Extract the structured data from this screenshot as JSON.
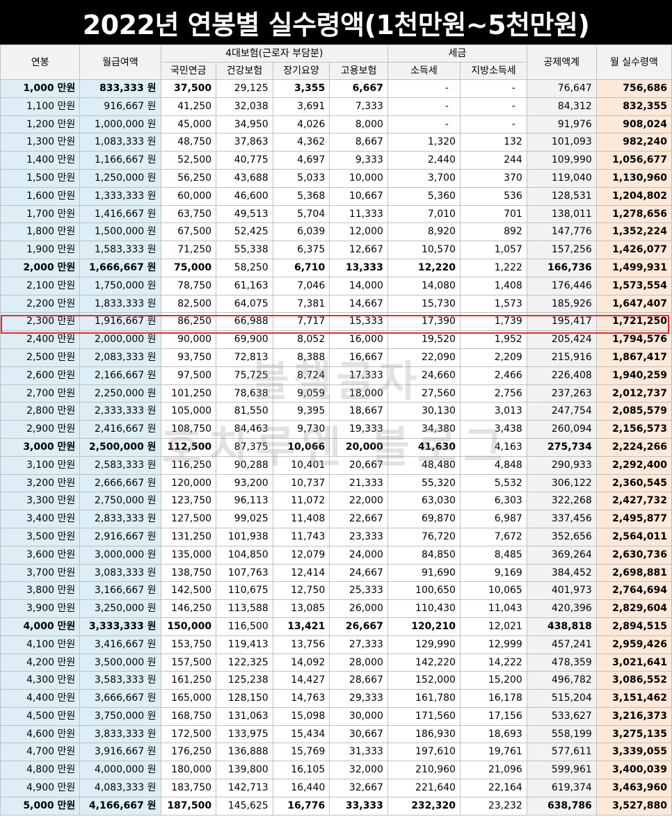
{
  "title": "2022년 연봉별 실수령액(1천만원~5천만원)",
  "headers": {
    "salary": "연봉",
    "monthly": "월급여액",
    "insurance_group": "4대보험(근로자 부담분)",
    "pension": "국민연금",
    "health": "건강보험",
    "longterm": "장기요양",
    "employment": "고용보험",
    "tax_group": "세금",
    "income_tax": "소득세",
    "local_tax": "지방소득세",
    "deduction_total": "공제액계",
    "net_monthly": "월 실수령액"
  },
  "watermark": {
    "line1": "블챌글자",
    "line2": "호치루엔 블로그"
  },
  "highlighted_row": 13,
  "bold_rows": [
    0,
    10,
    20,
    30,
    40
  ],
  "rows": [
    [
      "1,000 만원",
      "833,333 원",
      "37,500",
      "29,125",
      "3,355",
      "6,667",
      "-",
      "-",
      "76,647",
      "756,686"
    ],
    [
      "1,100 만원",
      "916,667 원",
      "41,250",
      "32,038",
      "3,691",
      "7,333",
      "-",
      "-",
      "84,312",
      "832,355"
    ],
    [
      "1,200 만원",
      "1,000,000 원",
      "45,000",
      "34,950",
      "4,026",
      "8,000",
      "-",
      "-",
      "91,976",
      "908,024"
    ],
    [
      "1,300 만원",
      "1,083,333 원",
      "48,750",
      "37,863",
      "4,362",
      "8,667",
      "1,320",
      "132",
      "101,093",
      "982,240"
    ],
    [
      "1,400 만원",
      "1,166,667 원",
      "52,500",
      "40,775",
      "4,697",
      "9,333",
      "2,440",
      "244",
      "109,990",
      "1,056,677"
    ],
    [
      "1,500 만원",
      "1,250,000 원",
      "56,250",
      "43,688",
      "5,033",
      "10,000",
      "3,700",
      "370",
      "119,040",
      "1,130,960"
    ],
    [
      "1,600 만원",
      "1,333,333 원",
      "60,000",
      "46,600",
      "5,368",
      "10,667",
      "5,360",
      "536",
      "128,531",
      "1,204,802"
    ],
    [
      "1,700 만원",
      "1,416,667 원",
      "63,750",
      "49,513",
      "5,704",
      "11,333",
      "7,010",
      "701",
      "138,011",
      "1,278,656"
    ],
    [
      "1,800 만원",
      "1,500,000 원",
      "67,500",
      "52,425",
      "6,039",
      "12,000",
      "8,920",
      "892",
      "147,776",
      "1,352,224"
    ],
    [
      "1,900 만원",
      "1,583,333 원",
      "71,250",
      "55,338",
      "6,375",
      "12,667",
      "10,570",
      "1,057",
      "157,256",
      "1,426,077"
    ],
    [
      "2,000 만원",
      "1,666,667 원",
      "75,000",
      "58,250",
      "6,710",
      "13,333",
      "12,220",
      "1,222",
      "166,736",
      "1,499,931"
    ],
    [
      "2,100 만원",
      "1,750,000 원",
      "78,750",
      "61,163",
      "7,046",
      "14,000",
      "14,080",
      "1,408",
      "176,446",
      "1,573,554"
    ],
    [
      "2,200 만원",
      "1,833,333 원",
      "82,500",
      "64,075",
      "7,381",
      "14,667",
      "15,730",
      "1,573",
      "185,926",
      "1,647,407"
    ],
    [
      "2,300 만원",
      "1,916,667 원",
      "86,250",
      "66,988",
      "7,717",
      "15,333",
      "17,390",
      "1,739",
      "195,417",
      "1,721,250"
    ],
    [
      "2,400 만원",
      "2,000,000 원",
      "90,000",
      "69,900",
      "8,052",
      "16,000",
      "19,520",
      "1,952",
      "205,424",
      "1,794,576"
    ],
    [
      "2,500 만원",
      "2,083,333 원",
      "93,750",
      "72,813",
      "8,388",
      "16,667",
      "22,090",
      "2,209",
      "215,916",
      "1,867,417"
    ],
    [
      "2,600 만원",
      "2,166,667 원",
      "97,500",
      "75,725",
      "8,724",
      "17,333",
      "24,660",
      "2,466",
      "226,408",
      "1,940,259"
    ],
    [
      "2,700 만원",
      "2,250,000 원",
      "101,250",
      "78,638",
      "9,059",
      "18,000",
      "27,560",
      "2,756",
      "237,263",
      "2,012,737"
    ],
    [
      "2,800 만원",
      "2,333,333 원",
      "105,000",
      "81,550",
      "9,395",
      "18,667",
      "30,130",
      "3,013",
      "247,754",
      "2,085,579"
    ],
    [
      "2,900 만원",
      "2,416,667 원",
      "108,750",
      "84,463",
      "9,730",
      "19,333",
      "34,380",
      "3,438",
      "260,094",
      "2,156,573"
    ],
    [
      "3,000 만원",
      "2,500,000 원",
      "112,500",
      "87,375",
      "10,066",
      "20,000",
      "41,630",
      "4,163",
      "275,734",
      "2,224,266"
    ],
    [
      "3,100 만원",
      "2,583,333 원",
      "116,250",
      "90,288",
      "10,401",
      "20,667",
      "48,480",
      "4,848",
      "290,933",
      "2,292,400"
    ],
    [
      "3,200 만원",
      "2,666,667 원",
      "120,000",
      "93,200",
      "10,737",
      "21,333",
      "55,320",
      "5,532",
      "306,122",
      "2,360,545"
    ],
    [
      "3,300 만원",
      "2,750,000 원",
      "123,750",
      "96,113",
      "11,072",
      "22,000",
      "63,030",
      "6,303",
      "322,268",
      "2,427,732"
    ],
    [
      "3,400 만원",
      "2,833,333 원",
      "127,500",
      "99,025",
      "11,408",
      "22,667",
      "69,870",
      "6,987",
      "337,456",
      "2,495,877"
    ],
    [
      "3,500 만원",
      "2,916,667 원",
      "131,250",
      "101,938",
      "11,743",
      "23,333",
      "76,720",
      "7,672",
      "352,656",
      "2,564,011"
    ],
    [
      "3,600 만원",
      "3,000,000 원",
      "135,000",
      "104,850",
      "12,079",
      "24,000",
      "84,850",
      "8,485",
      "369,264",
      "2,630,736"
    ],
    [
      "3,700 만원",
      "3,083,333 원",
      "138,750",
      "107,763",
      "12,414",
      "24,667",
      "91,690",
      "9,169",
      "384,452",
      "2,698,881"
    ],
    [
      "3,800 만원",
      "3,166,667 원",
      "142,500",
      "110,675",
      "12,750",
      "25,333",
      "100,650",
      "10,065",
      "401,973",
      "2,764,694"
    ],
    [
      "3,900 만원",
      "3,250,000 원",
      "146,250",
      "113,588",
      "13,085",
      "26,000",
      "110,430",
      "11,043",
      "420,396",
      "2,829,604"
    ],
    [
      "4,000 만원",
      "3,333,333 원",
      "150,000",
      "116,500",
      "13,421",
      "26,667",
      "120,210",
      "12,021",
      "438,818",
      "2,894,515"
    ],
    [
      "4,100 만원",
      "3,416,667 원",
      "153,750",
      "119,413",
      "13,756",
      "27,333",
      "129,990",
      "12,999",
      "457,241",
      "2,959,426"
    ],
    [
      "4,200 만원",
      "3,500,000 원",
      "157,500",
      "122,325",
      "14,092",
      "28,000",
      "142,220",
      "14,222",
      "478,359",
      "3,021,641"
    ],
    [
      "4,300 만원",
      "3,583,333 원",
      "161,250",
      "125,238",
      "14,427",
      "28,667",
      "152,000",
      "15,200",
      "496,782",
      "3,086,552"
    ],
    [
      "4,400 만원",
      "3,666,667 원",
      "165,000",
      "128,150",
      "14,763",
      "29,333",
      "161,780",
      "16,178",
      "515,204",
      "3,151,462"
    ],
    [
      "4,500 만원",
      "3,750,000 원",
      "168,750",
      "131,063",
      "15,098",
      "30,000",
      "171,560",
      "17,156",
      "533,627",
      "3,216,373"
    ],
    [
      "4,600 만원",
      "3,833,333 원",
      "172,500",
      "133,975",
      "15,434",
      "30,667",
      "186,930",
      "18,693",
      "558,199",
      "3,275,135"
    ],
    [
      "4,700 만원",
      "3,916,667 원",
      "176,250",
      "136,888",
      "15,769",
      "31,333",
      "197,610",
      "19,761",
      "577,611",
      "3,339,055"
    ],
    [
      "4,800 만원",
      "4,000,000 원",
      "180,000",
      "139,800",
      "16,105",
      "32,000",
      "210,960",
      "21,096",
      "599,961",
      "3,400,039"
    ],
    [
      "4,900 만원",
      "4,083,333 원",
      "183,750",
      "142,713",
      "16,440",
      "32,667",
      "221,640",
      "22,164",
      "619,374",
      "3,463,960"
    ],
    [
      "5,000 만원",
      "4,166,667 원",
      "187,500",
      "145,625",
      "16,776",
      "33,333",
      "232,320",
      "23,232",
      "638,786",
      "3,527,880"
    ]
  ]
}
